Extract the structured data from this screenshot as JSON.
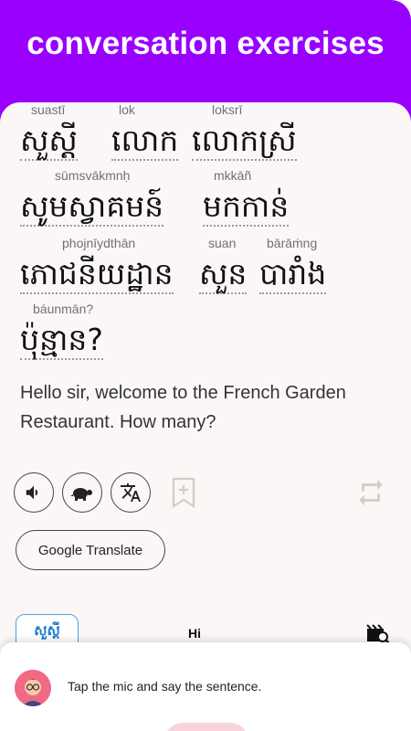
{
  "header": {
    "title": "conversation exercises"
  },
  "lines": [
    [
      {
        "roman": "suastī",
        "khmer": "សួស្តី"
      },
      {
        "roman": "lok",
        "khmer": "លោក"
      },
      {
        "roman": "loksrī",
        "khmer": "លោកស្រី"
      }
    ],
    [
      {
        "roman": "sūmsvākmnḥ",
        "khmer": "សូមស្វាគមន៍"
      },
      {
        "roman": "mkkāñ",
        "khmer": "មកកាន់"
      }
    ],
    [
      {
        "roman": "phojnīydthān",
        "khmer": "ភោជនីយដ្ឋាន"
      },
      {
        "roman": "suan",
        "khmer": "សួន"
      },
      {
        "roman": "bārāṁng",
        "khmer": "បារាំង"
      }
    ],
    [
      {
        "roman": "báunmān?",
        "khmer": "ប៉ុន្មាន?"
      }
    ]
  ],
  "translation": "Hello sir, welcome to the French Garden Restaurant. How many?",
  "actions": {
    "speaker_icon": "speaker-icon",
    "slow_icon": "turtle-icon",
    "translate_icon": "translate-icon",
    "bookmark_icon": "bookmark-add-icon",
    "repeat_icon": "repeat-icon",
    "google_translate_label": "Google Translate"
  },
  "chip": {
    "label": "សួស្តី"
  },
  "hi_label": "Hi",
  "bottom_sheet": {
    "prompt": "Tap the mic and say the sentence."
  },
  "colors": {
    "header": "#9900ff",
    "card": "#fcf7f7",
    "chip_border": "#4aa3e8",
    "mic": "#f9d3dc"
  }
}
